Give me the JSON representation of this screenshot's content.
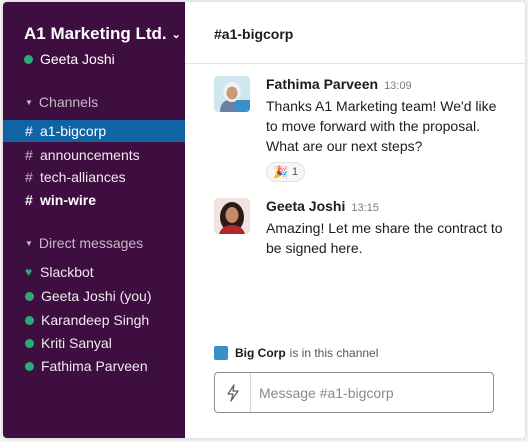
{
  "workspace": {
    "name": "A1 Marketing Ltd.",
    "current_user": "Geeta Joshi"
  },
  "sidebar": {
    "channels_heading": "Channels",
    "channels": [
      {
        "label": "a1-bigcorp",
        "state": "active"
      },
      {
        "label": "announcements",
        "state": "normal"
      },
      {
        "label": "tech-alliances",
        "state": "normal"
      },
      {
        "label": "win-wire",
        "state": "unread"
      }
    ],
    "dm_heading": "Direct messages",
    "dms": [
      {
        "label": "Slackbot",
        "icon": "heart-icon"
      },
      {
        "label": "Geeta Joshi (you)",
        "icon": "presence-dot-icon"
      },
      {
        "label": "Karandeep Singh",
        "icon": "presence-dot-icon"
      },
      {
        "label": "Kriti Sanyal",
        "icon": "presence-dot-icon"
      },
      {
        "label": "Fathima Parveen",
        "icon": "presence-dot-icon"
      }
    ]
  },
  "channel": {
    "title": "#a1-bigcorp"
  },
  "messages": [
    {
      "author": "Fathima Parveen",
      "time": "13:09",
      "text": "Thanks A1 Marketing team! We'd like to move forward with the proposal. What are our next steps?",
      "reaction": {
        "emoji": "🎉",
        "count": "1"
      }
    },
    {
      "author": "Geeta Joshi",
      "time": "13:15",
      "text": "Amazing! Let me share the contract to be signed here."
    }
  ],
  "org_note": {
    "org": "Big Corp",
    "suffix": "is in this channel"
  },
  "composer": {
    "placeholder": "Message #a1-bigcorp"
  },
  "colors": {
    "sidebar_bg": "#3f0e40",
    "active_item": "#1164a3",
    "presence": "#2bac76",
    "org_badge": "#3a8fc8"
  }
}
